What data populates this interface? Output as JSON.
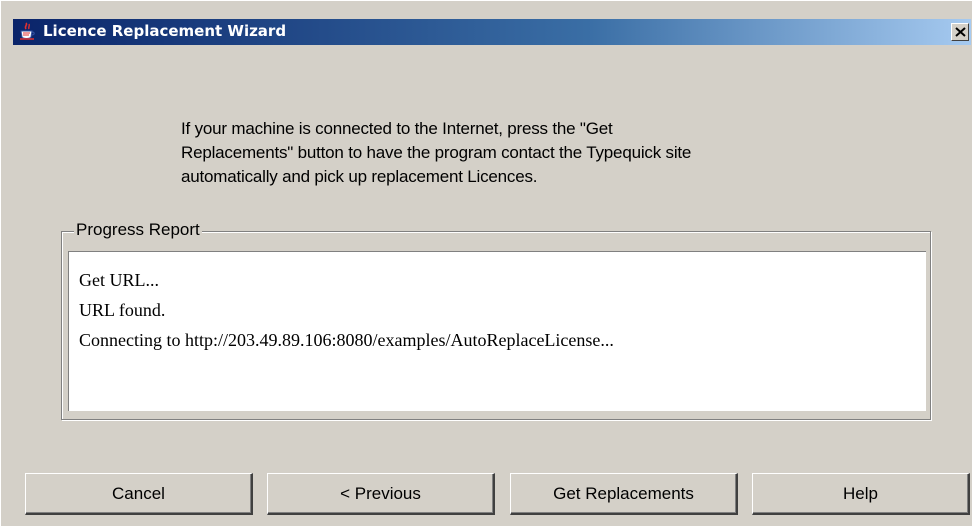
{
  "window": {
    "title": "Licence Replacement Wizard",
    "title_icon": "java-coffee-cup-icon",
    "close_icon": "close-icon",
    "titlebar_color_start": "#0a246a",
    "titlebar_color_end": "#a6caf0",
    "background_color": "#d4d0c8"
  },
  "instruction": {
    "lines": [
      "If your machine is connected to the Internet, press the \"Get",
      "Replacements\" button to have the program contact the Typequick site",
      "automatically and pick up replacement Licences."
    ]
  },
  "progress_report": {
    "label": "Progress Report",
    "log_lines": [
      "Get URL...",
      "URL found.",
      "Connecting to http://203.49.89.106:8080/examples/AutoReplaceLicense..."
    ]
  },
  "buttons": {
    "cancel_label": "Cancel",
    "previous_label": "< Previous",
    "get_replacements_label": "Get Replacements",
    "help_label": "Help"
  }
}
